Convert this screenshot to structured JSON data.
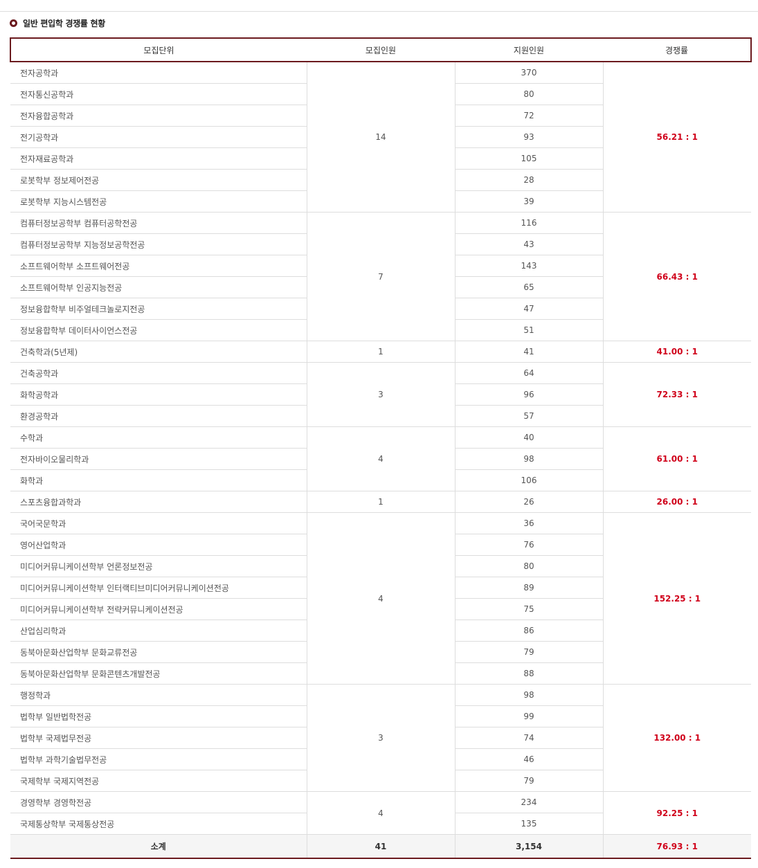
{
  "section_title": "일반 편입학 경쟁률 현황",
  "columns": [
    "모집단위",
    "모집인원",
    "지원인원",
    "경쟁률"
  ],
  "groups": [
    {
      "quota": "14",
      "ratio": "56.21 : 1",
      "rows": [
        {
          "unit": "전자공학과",
          "applicants": "370"
        },
        {
          "unit": "전자통신공학과",
          "applicants": "80"
        },
        {
          "unit": "전자융합공학과",
          "applicants": "72"
        },
        {
          "unit": "전기공학과",
          "applicants": "93"
        },
        {
          "unit": "전자재료공학과",
          "applicants": "105"
        },
        {
          "unit": "로봇학부 정보제어전공",
          "applicants": "28"
        },
        {
          "unit": "로봇학부 지능시스템전공",
          "applicants": "39"
        }
      ]
    },
    {
      "quota": "7",
      "ratio": "66.43 : 1",
      "rows": [
        {
          "unit": "컴퓨터정보공학부 컴퓨터공학전공",
          "applicants": "116"
        },
        {
          "unit": "컴퓨터정보공학부 지능정보공학전공",
          "applicants": "43"
        },
        {
          "unit": "소프트웨어학부 소프트웨어전공",
          "applicants": "143"
        },
        {
          "unit": "소프트웨어학부 인공지능전공",
          "applicants": "65"
        },
        {
          "unit": "정보융합학부 비주얼테크놀로지전공",
          "applicants": "47"
        },
        {
          "unit": "정보융합학부 데이터사이언스전공",
          "applicants": "51"
        }
      ]
    },
    {
      "quota": "1",
      "ratio": "41.00 : 1",
      "rows": [
        {
          "unit": "건축학과(5년제)",
          "applicants": "41"
        }
      ]
    },
    {
      "quota": "3",
      "ratio": "72.33 : 1",
      "rows": [
        {
          "unit": "건축공학과",
          "applicants": "64"
        },
        {
          "unit": "화학공학과",
          "applicants": "96"
        },
        {
          "unit": "환경공학과",
          "applicants": "57"
        }
      ]
    },
    {
      "quota": "4",
      "ratio": "61.00 : 1",
      "rows": [
        {
          "unit": "수학과",
          "applicants": "40"
        },
        {
          "unit": "전자바이오물리학과",
          "applicants": "98"
        },
        {
          "unit": "화학과",
          "applicants": "106"
        }
      ]
    },
    {
      "quota": "1",
      "ratio": "26.00 : 1",
      "rows": [
        {
          "unit": "스포츠융합과학과",
          "applicants": "26"
        }
      ]
    },
    {
      "quota": "4",
      "ratio": "152.25 : 1",
      "rows": [
        {
          "unit": "국어국문학과",
          "applicants": "36"
        },
        {
          "unit": "영어산업학과",
          "applicants": "76"
        },
        {
          "unit": "미디어커뮤니케이션학부 언론정보전공",
          "applicants": "80"
        },
        {
          "unit": "미디어커뮤니케이션학부 인터랙티브미디어커뮤니케이션전공",
          "applicants": "89"
        },
        {
          "unit": "미디어커뮤니케이션학부 전략커뮤니케이션전공",
          "applicants": "75"
        },
        {
          "unit": "산업심리학과",
          "applicants": "86"
        },
        {
          "unit": "동북아문화산업학부 문화교류전공",
          "applicants": "79"
        },
        {
          "unit": "동북아문화산업학부 문화콘텐츠개발전공",
          "applicants": "88"
        }
      ]
    },
    {
      "quota": "3",
      "ratio": "132.00 : 1",
      "rows": [
        {
          "unit": "행정학과",
          "applicants": "98"
        },
        {
          "unit": "법학부 일반법학전공",
          "applicants": "99"
        },
        {
          "unit": "법학부 국제법무전공",
          "applicants": "74"
        },
        {
          "unit": "법학부 과학기술법무전공",
          "applicants": "46"
        },
        {
          "unit": "국제학부 국제지역전공",
          "applicants": "79"
        }
      ]
    },
    {
      "quota": "4",
      "ratio": "92.25 : 1",
      "rows": [
        {
          "unit": "경영학부 경영학전공",
          "applicants": "234"
        },
        {
          "unit": "국제통상학부 국제통상전공",
          "applicants": "135"
        }
      ]
    }
  ],
  "subtotal": {
    "label": "소계",
    "quota": "41",
    "applicants": "3,154",
    "ratio": "76.93 : 1"
  },
  "colors": {
    "accent": "#6b1a1e",
    "ratio_text": "#d0021b",
    "border": "#dddddd"
  }
}
